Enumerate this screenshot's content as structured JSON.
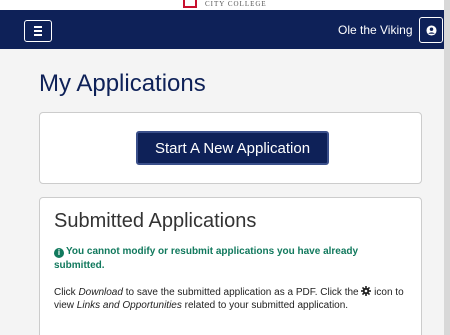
{
  "header": {
    "logo_text": "CITY COLLEGE",
    "user_name": "Ole the Viking",
    "menu_icon": "hamburger-menu-icon",
    "user_icon": "user-circle-icon"
  },
  "main": {
    "title": "My Applications",
    "start_button_label": "Start A New Application",
    "submitted": {
      "title": "Submitted Applications",
      "notice": "You cannot modify or resubmit applications you have already submitted.",
      "desc_1": "Click ",
      "desc_download": "Download",
      "desc_2": " to save the submitted application as a PDF. Click the ",
      "desc_3": " icon to view ",
      "desc_links": "Links and Opportunities",
      "desc_4": " related to your submitted application."
    }
  },
  "colors": {
    "navy": "#0e2158",
    "notice_green": "#11795d",
    "logo_red": "#c8102e"
  }
}
